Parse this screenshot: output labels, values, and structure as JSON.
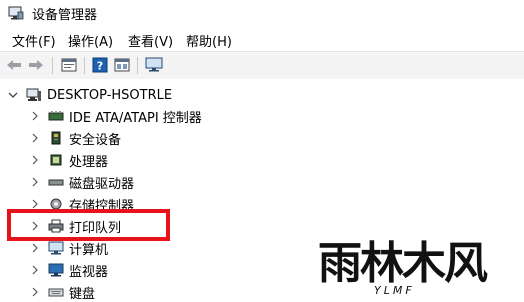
{
  "window": {
    "title": "设备管理器"
  },
  "menu": [
    {
      "label": "文件(F)"
    },
    {
      "label": "操作(A)"
    },
    {
      "label": "查看(V)"
    },
    {
      "label": "帮助(H)"
    }
  ],
  "toolbar": {
    "icons": [
      "back-arrow-icon",
      "forward-arrow-icon",
      "properties-icon",
      "help-icon",
      "show-hidden-icon",
      "monitor-icon"
    ]
  },
  "tree": {
    "root": {
      "label": "DESKTOP-HSOTRLE",
      "expanded": true
    },
    "items": [
      {
        "label": "IDE ATA/ATAPI 控制器",
        "icon": "ide-controller-icon"
      },
      {
        "label": "安全设备",
        "icon": "security-device-icon"
      },
      {
        "label": "处理器",
        "icon": "processor-icon"
      },
      {
        "label": "磁盘驱动器",
        "icon": "disk-drive-icon"
      },
      {
        "label": "存储控制器",
        "icon": "storage-controller-icon"
      },
      {
        "label": "打印队列",
        "icon": "printer-icon",
        "highlighted": true
      },
      {
        "label": "计算机",
        "icon": "computer-icon"
      },
      {
        "label": "监视器",
        "icon": "monitor-icon"
      },
      {
        "label": "键盘",
        "icon": "keyboard-icon"
      }
    ]
  },
  "highlight_color": "#e8121a",
  "watermark": {
    "main": "雨林木风",
    "sub": "YLMF"
  }
}
